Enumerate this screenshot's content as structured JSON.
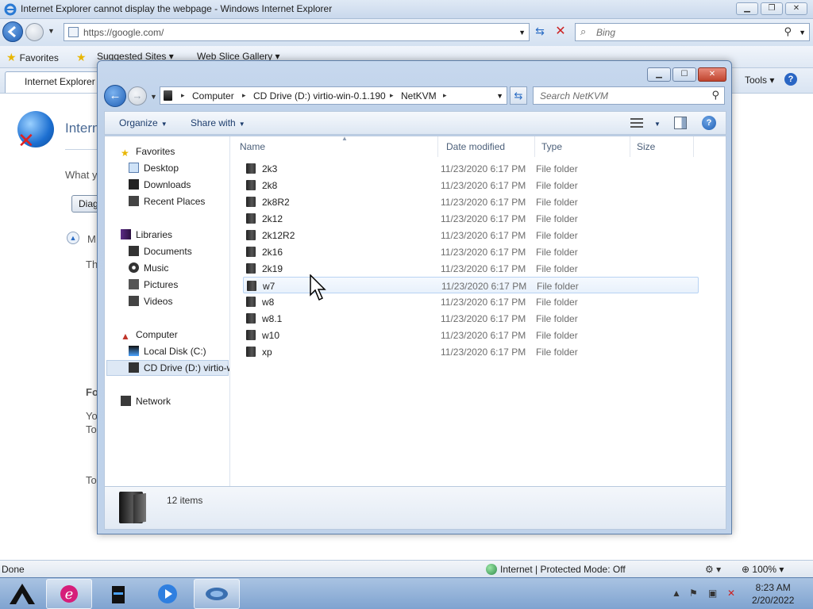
{
  "ie": {
    "title": "Internet Explorer cannot display the webpage - Windows Internet Explorer",
    "address": "https://google.com/",
    "search_placeholder": "Bing",
    "favorites_label": "Favorites",
    "fav_items": [
      "Suggested Sites",
      "Web Slice Gallery"
    ],
    "tab_title": "Internet Explorer",
    "tools_label": "Tools",
    "content": {
      "heading": "Intern",
      "what": "What y",
      "diag_btn": "Diag",
      "more": "M",
      "th": "Th",
      "fo": "Fo",
      "yo": "Yo",
      "to1": "To",
      "to2": "To"
    },
    "status": {
      "done": "Done",
      "zone": "Internet | Protected Mode: Off",
      "zoom": "100%"
    }
  },
  "explorer": {
    "breadcrumb": [
      "Computer",
      "CD Drive (D:) virtio-win-0.1.190",
      "NetKVM"
    ],
    "search_placeholder": "Search NetKVM",
    "toolbar": {
      "organize": "Organize",
      "share": "Share with"
    },
    "nav": {
      "favorites": "Favorites",
      "favorites_items": [
        "Desktop",
        "Downloads",
        "Recent Places"
      ],
      "libraries": "Libraries",
      "libraries_items": [
        "Documents",
        "Music",
        "Pictures",
        "Videos"
      ],
      "computer": "Computer",
      "computer_items": [
        "Local Disk (C:)",
        "CD Drive (D:) virtio-w"
      ],
      "network": "Network"
    },
    "columns": {
      "name": "Name",
      "date": "Date modified",
      "type": "Type",
      "size": "Size"
    },
    "files": [
      {
        "name": "2k3",
        "date": "11/23/2020 6:17 PM",
        "type": "File folder"
      },
      {
        "name": "2k8",
        "date": "11/23/2020 6:17 PM",
        "type": "File folder"
      },
      {
        "name": "2k8R2",
        "date": "11/23/2020 6:17 PM",
        "type": "File folder"
      },
      {
        "name": "2k12",
        "date": "11/23/2020 6:17 PM",
        "type": "File folder"
      },
      {
        "name": "2k12R2",
        "date": "11/23/2020 6:17 PM",
        "type": "File folder"
      },
      {
        "name": "2k16",
        "date": "11/23/2020 6:17 PM",
        "type": "File folder"
      },
      {
        "name": "2k19",
        "date": "11/23/2020 6:17 PM",
        "type": "File folder"
      },
      {
        "name": "w7",
        "date": "11/23/2020 6:17 PM",
        "type": "File folder"
      },
      {
        "name": "w8",
        "date": "11/23/2020 6:17 PM",
        "type": "File folder"
      },
      {
        "name": "w8.1",
        "date": "11/23/2020 6:17 PM",
        "type": "File folder"
      },
      {
        "name": "w10",
        "date": "11/23/2020 6:17 PM",
        "type": "File folder"
      },
      {
        "name": "xp",
        "date": "11/23/2020 6:17 PM",
        "type": "File folder"
      }
    ],
    "hovered_index": 7,
    "item_count": "12 items"
  },
  "taskbar": {
    "time": "8:23 AM",
    "date": "2/20/2022"
  },
  "icons": {
    "ie_logo": "internet-explorer-icon",
    "back": "back-arrow-icon",
    "forward": "forward-arrow-icon",
    "refresh": "refresh-icon",
    "stop": "stop-icon",
    "search": "search-icon",
    "star": "star-icon",
    "folder": "folder-icon",
    "help": "help-icon"
  },
  "colors": {
    "accent": "#1f5fb5",
    "stop_red": "#cc2222",
    "close_red": "#c0442e",
    "hover_row": "#e8f1fc"
  }
}
